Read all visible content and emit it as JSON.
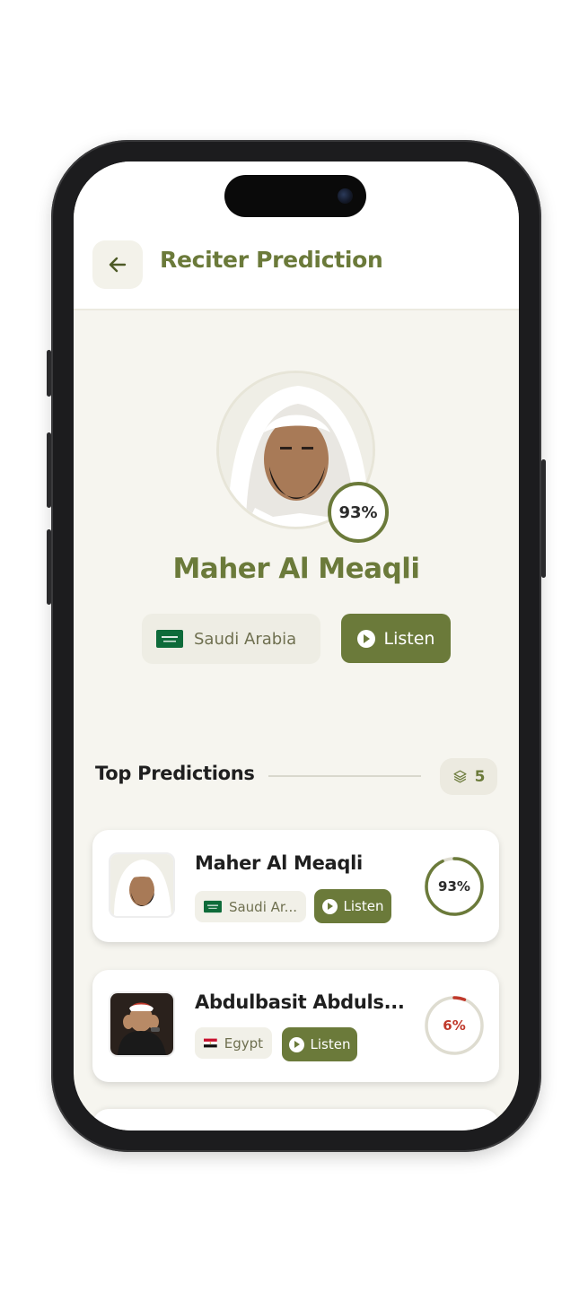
{
  "header": {
    "title": "Reciter Prediction",
    "back_icon": "arrow-left-icon"
  },
  "hero": {
    "name": "Maher Al Meaqli",
    "confidence": "93%",
    "country": "Saudi Arabia",
    "listen_label": "Listen"
  },
  "section": {
    "title": "Top Predictions",
    "count": "5",
    "count_icon": "layers-icon"
  },
  "predictions": [
    {
      "name": "Maher Al Meaqli",
      "country": "Saudi Ar...",
      "listen_label": "Listen",
      "percent_label": "93%",
      "percent": 0.93,
      "ring_color": "#6b7a3a",
      "label_color": "#2b2b2b"
    },
    {
      "name": "Abdulbasit Abduls...",
      "country": "Egypt",
      "listen_label": "Listen",
      "percent_label": "6%",
      "percent": 0.06,
      "ring_color": "#c0392b",
      "label_color": "#c0392b"
    }
  ],
  "colors": {
    "accent": "#6b7a3a",
    "background": "#f6f5ef",
    "low_confidence": "#c0392b"
  }
}
